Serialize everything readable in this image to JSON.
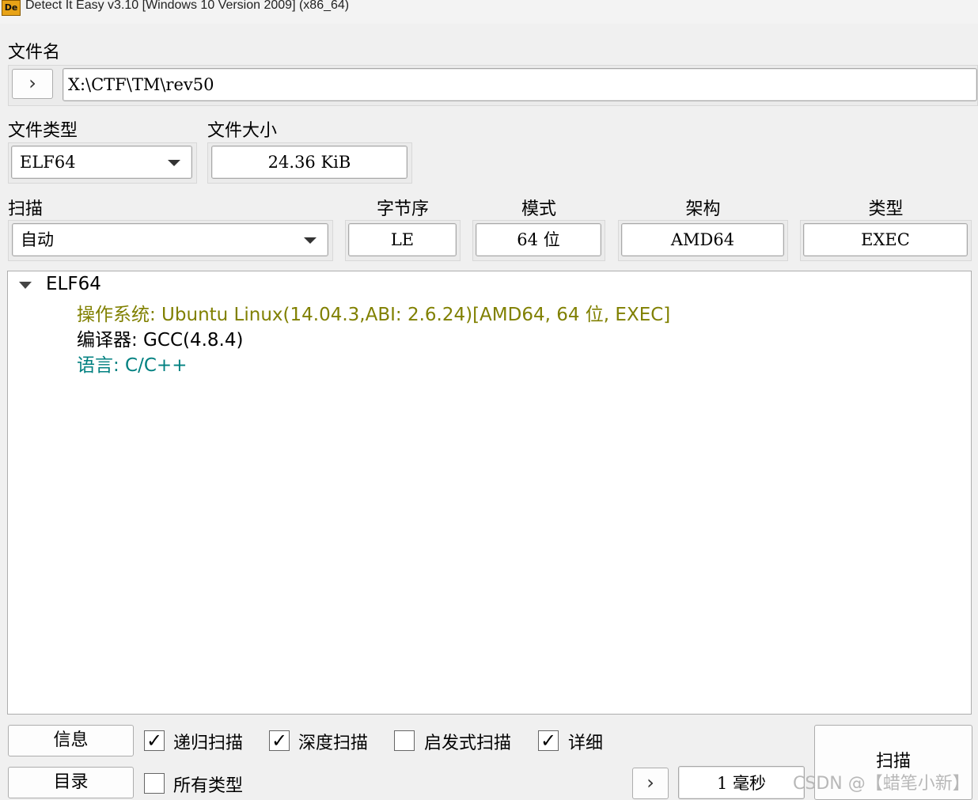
{
  "window": {
    "title": "Detect It Easy v3.10 [Windows 10 Version 2009] (x86_64)",
    "icon_text": "De"
  },
  "file": {
    "label": "文件名",
    "browse_glyph": "›",
    "path": "X:\\CTF\\TM\\rev50"
  },
  "file_type": {
    "label": "文件类型",
    "value": "ELF64"
  },
  "file_size": {
    "label": "文件大小",
    "value": "24.36 KiB"
  },
  "scan": {
    "label": "扫描",
    "value": "自动"
  },
  "endian": {
    "label": "字节序",
    "value": "LE"
  },
  "mode": {
    "label": "模式",
    "value": "64 位"
  },
  "arch": {
    "label": "架构",
    "value": "AMD64"
  },
  "type": {
    "label": "类型",
    "value": "EXEC"
  },
  "results": {
    "root": "ELF64",
    "items": [
      {
        "text": "操作系统: Ubuntu Linux(14.04.3,ABI: 2.6.24)[AMD64, 64 位, EXEC]",
        "color": "#808000"
      },
      {
        "text": "编译器: GCC(4.8.4)",
        "color": "#000000"
      },
      {
        "text": "语言: C/C++",
        "color": "#008080"
      }
    ]
  },
  "bottom": {
    "info_button": "信息",
    "dir_button": "目录",
    "scan_button": "扫描",
    "recursive_scan": {
      "label": "递归扫描",
      "checked": true
    },
    "deep_scan": {
      "label": "深度扫描",
      "checked": true
    },
    "heuristic_scan": {
      "label": "启发式扫描",
      "checked": false
    },
    "verbose": {
      "label": "详细",
      "checked": true
    },
    "all_types": {
      "label": "所有类型",
      "checked": false
    },
    "next_glyph": "›",
    "time_value": "1",
    "time_unit": "毫秒"
  },
  "watermark": "CSDN @【蜡笔小新】"
}
